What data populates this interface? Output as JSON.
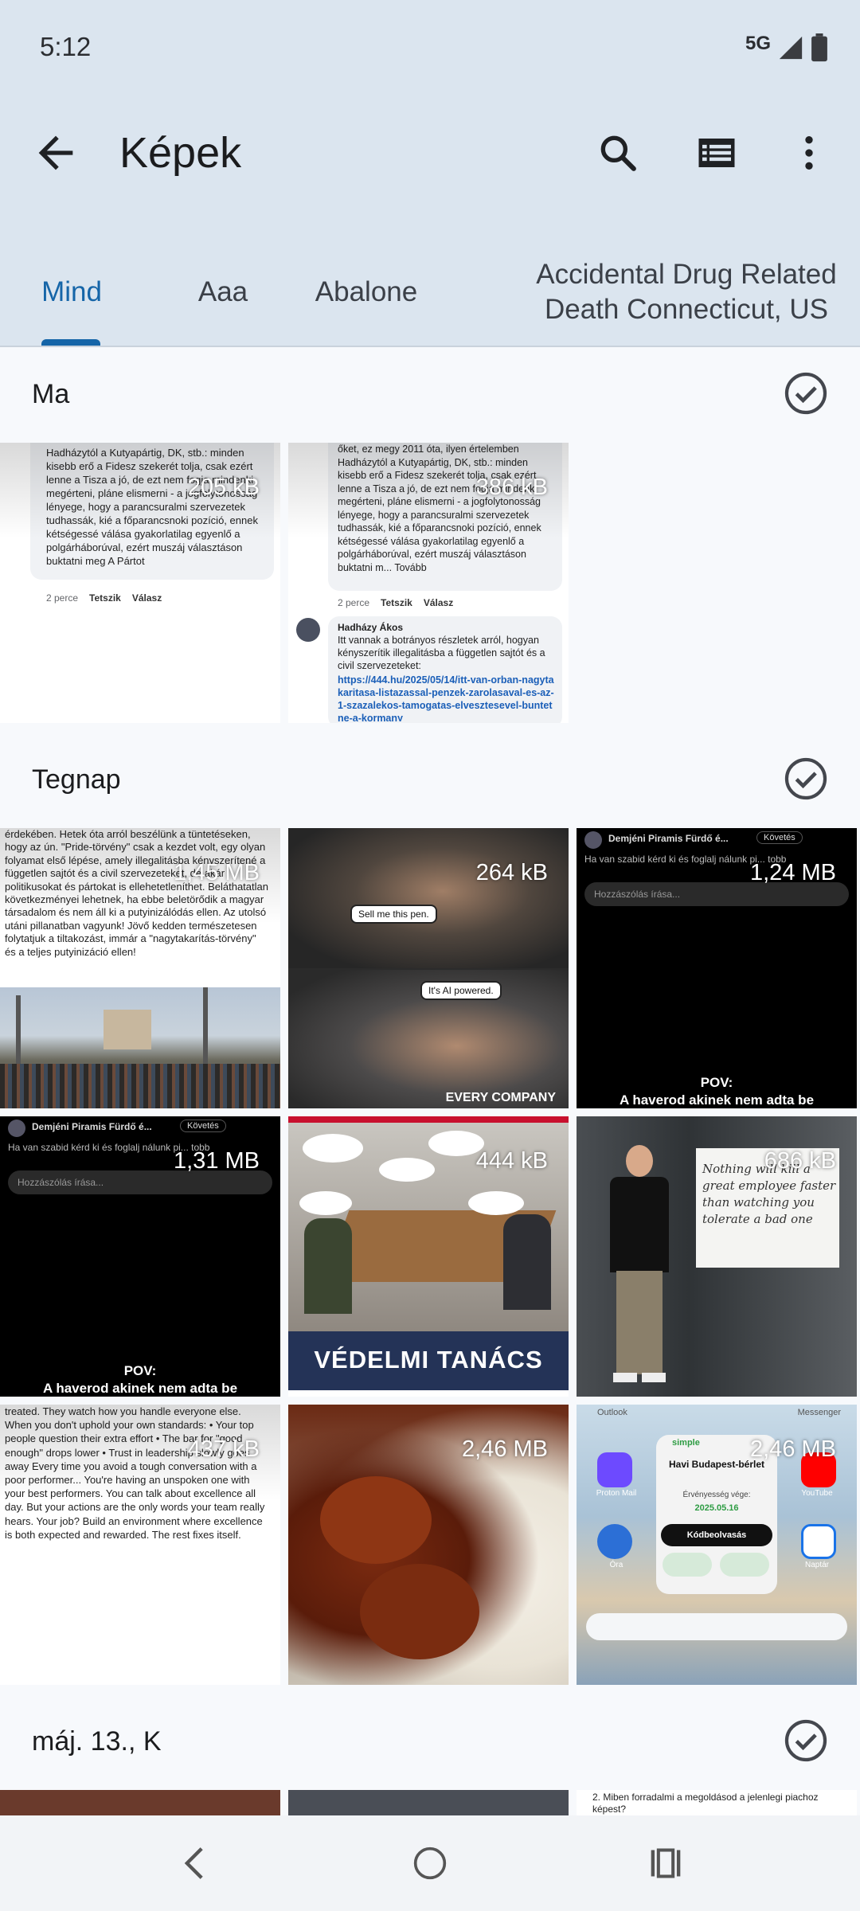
{
  "status": {
    "time": "5:12",
    "network": "5G"
  },
  "appbar": {
    "title": "Képek"
  },
  "tabs": [
    {
      "label": "Mind"
    },
    {
      "label": "Aaa"
    },
    {
      "label": "Abalone"
    },
    {
      "label": "Accidental Drug Related Death Connecticut, US"
    }
  ],
  "sections": [
    {
      "title": "Ma"
    },
    {
      "title": "Tegnap"
    },
    {
      "title": "máj. 13., K"
    }
  ],
  "thumbs": {
    "ma1": {
      "size": "205 kB",
      "text": "Hadházytól a Kutyapártig, DK, stb.: minden kisebb erő a Fidesz szekerét tolja, csak ezért lenne a Tisza a jó, de ezt nem fogja mindenki megérteni, pláne elismerni - a jogfolytonosság lénye­ge, hogy a parancsuralmi szervezetek tudhassák, kié a főparancsnoki pozíció, ennek kétségessé válása gyakorlatilag egyenlő a polgárháborúval, ezért muszáj választáson buktatni meg A Pártot",
      "time": "2 perce",
      "like": "Tetszik",
      "reply": "Válasz"
    },
    "ma2": {
      "size": "386 kB",
      "text": "őket, ez megy 2011 óta, ilyen értelemben Hadházytól a Kutyapártig, DK, stb.: minden kisebb erő a Fidesz szekerét tolja, csak ezért lenne a Tisza a jó, de ezt nem fogja mindenki megérteni, pláne elismerni - a jogfolytonosság lényege, hogy a parancsuralmi szervezetek tudhassák, kié a főparancsnoki pozíció, ennek kétségessé válása gyakorlatilag egyenlő a polgárháborúval, ezért muszáj választáson buktatni m... Tovább",
      "time": "2 perce",
      "like": "Tetszik",
      "reply": "Válasz",
      "author": "Hadházy Ákos",
      "post": "Itt vannak a botrányos részletek arról, hogyan kényszerítik illegalitásba a független sajtót és a civil szervezeteket:",
      "link": "https://444.hu/2025/05/14/itt-van-orban-nagytakaritasa-listazassal-penzek-zarolasaval-es-az-1-szazalekos-tamogatas-elvesztesevel-buntetne-a-kormany"
    },
    "t1": {
      "size": "1,45 MB",
      "text": "érdekében. Hetek óta arról beszélünk a tüntetéseken, hogy az ún. \"Pride-törvény\" csak a kezdet volt, egy olyan folyamat első lépése, amely illegalitásba kényszerítené a független sajtót és a civil szervezeteket, de akár politikusokat és pártokat is ellehetetleníthet. Beláthatatlan következményei lehetnek, ha ebbe beletörődik a magyar társadalom és nem áll ki a putyinizálódás ellen. Az utolsó utáni pillanatban vagyunk! Jövő kedden természetesen folytatjuk a tiltakozást, immár a \"nagytakarítás-törvény\" és a teljes putyinizáció ellen!"
    },
    "t2": {
      "size": "264 kB",
      "bubble1": "Sell me this pen.",
      "bubble2": "It's AI powered.",
      "caption": "EVERY COMPANY"
    },
    "t3": {
      "size": "1,24 MB",
      "page": "Demjéni Piramis Fürdő é...",
      "follow": "Követés",
      "sub": "Ha van szabid kérd ki és foglalj nálunk pi... tobb",
      "comment": "Hozzászólás írása...",
      "pov": "POV:",
      "caption": "A haverod akinek nem adta be"
    },
    "t4": {
      "size": "1,31 MB",
      "page": "Demjéni Piramis Fürdő é...",
      "follow": "Követés",
      "sub": "Ha van szabid kérd ki és foglalj nálunk pi... tobb",
      "comment": "Hozzászólás írása...",
      "pov": "POV:",
      "caption": "A haverod akinek nem adta be"
    },
    "t5": {
      "size": "444 kB",
      "caption": "VÉDELMI TANÁCS"
    },
    "t6": {
      "size": "686 kB",
      "board": "Nothing will kill a great employee faster than watching you tolerate a bad one"
    },
    "t7": {
      "size": "437 kB",
      "text": "treated. They watch how you handle everyone else. When you don't uphold your own standards: • Your top people question their extra effort • The bar for \"good enough\" drops lower • Trust in leadership slowly goes away Every time you avoid a tough conversation with a poor performer... You're having an unspoken one with your best performers. You can talk about excellence all day. But your actions are the only words your team really hears. Your job? Build an environment where excellence is both expected and rewarded. The rest fixes itself."
    },
    "t8": {
      "size": "2,46 MB"
    },
    "t9": {
      "size": "2,46 MB",
      "brand": "simple",
      "card": "Havi Budapest-bérlet",
      "validity": "Érvényesség vége:",
      "date": "2025.05.16",
      "btn": "Kódbeolvasás",
      "app1": "Proton Mail",
      "app2": "YouTube",
      "app3": "Óra",
      "app4": "Naptár",
      "top1": "Outlook",
      "top2": "Messenger"
    },
    "m1": {},
    "m2": {},
    "m3": {
      "text": "2. Miben forradalmi a megoldásod a jelenlegi piachoz képest?"
    }
  },
  "colors": {
    "accent": "#1565a8",
    "appbar_bg": "#dbe5ef"
  }
}
